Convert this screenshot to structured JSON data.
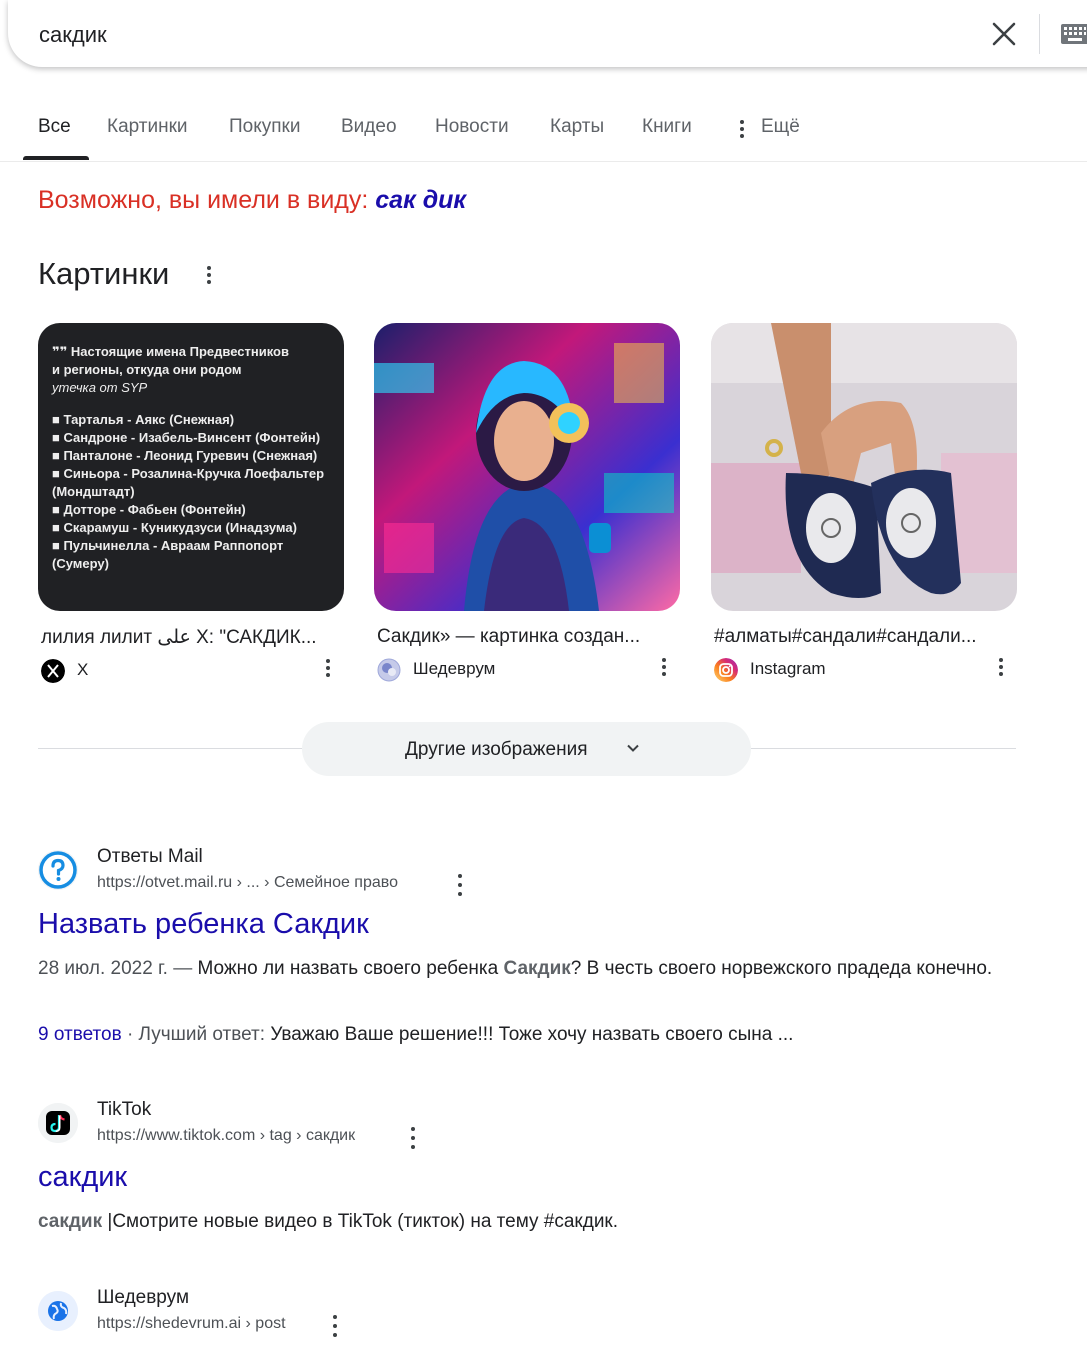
{
  "search": {
    "query": "сакдик"
  },
  "tabs": [
    {
      "label": "Все"
    },
    {
      "label": "Картинки"
    },
    {
      "label": "Покупки"
    },
    {
      "label": "Видео"
    },
    {
      "label": "Новости"
    },
    {
      "label": "Карты"
    },
    {
      "label": "Книги"
    },
    {
      "label": "Ещё"
    }
  ],
  "did_you_mean": {
    "prefix": "Возможно, вы имели в виду:",
    "suggestion": "сак дик"
  },
  "images_section": {
    "heading": "Картинки",
    "cards": [
      {
        "title": "лилия лилит على X: \"САКДИК...",
        "source": "X",
        "thumb_lines": [
          "❞❞ Настоящие имена Предвестников",
          "и регионы, откуда они родом",
          "утечка от SYP",
          "■ Тарталья - Аякс (Снежная)",
          "■ Сандроне - Изабель-Винсент (Фонтейн)",
          "■ Панталоне - Леонид Гуревич (Снежная)",
          "■ Синьора - Розалина-Кручка Лоефальтер (Мондштадт)",
          "■ Дотторе - Фабьен (Фонтейн)",
          "■ Скарамуш - Куникудзуси (Инадзума)",
          "■ Пульчинелла - Авраам Раппопорт (Сумеру)"
        ]
      },
      {
        "title": "Сакдик» — картинка создан...",
        "source": "Шедеврум"
      },
      {
        "title": "#алматы#сандали#сандали...",
        "source": "Instagram"
      }
    ],
    "more_button": "Другие изображения"
  },
  "results": [
    {
      "site": "Ответы Mail",
      "url": "https://otvet.mail.ru › ... › Семейное право",
      "title": "Назвать ребенка Сакдик",
      "date": "28 июл. 2022 г. — ",
      "snippet_pre": "Можно ли назвать своего ребенка ",
      "snippet_bold": "Сакдик",
      "snippet_post": "? В честь своего норвежского прадеда конечно.",
      "answers_link": "9 ответов",
      "best_label": " · Лучший ответ: ",
      "best_text": "Уважаю Ваше решение!!! Тоже хочу назвать своего сына ..."
    },
    {
      "site": "TikTok",
      "url": "https://www.tiktok.com › tag › сакдик",
      "title": "сакдик",
      "snippet_bold": "сакдик",
      "snippet_post": " |Смотрите новые видео в TikTok (тикток) на тему #сакдик."
    },
    {
      "site": "Шедеврум",
      "url": "https://shedevrum.ai › post"
    }
  ],
  "colors": {
    "link": "#1a0dab",
    "did_you_mean": "#d93025",
    "text": "#202124",
    "muted": "#4d5156"
  }
}
